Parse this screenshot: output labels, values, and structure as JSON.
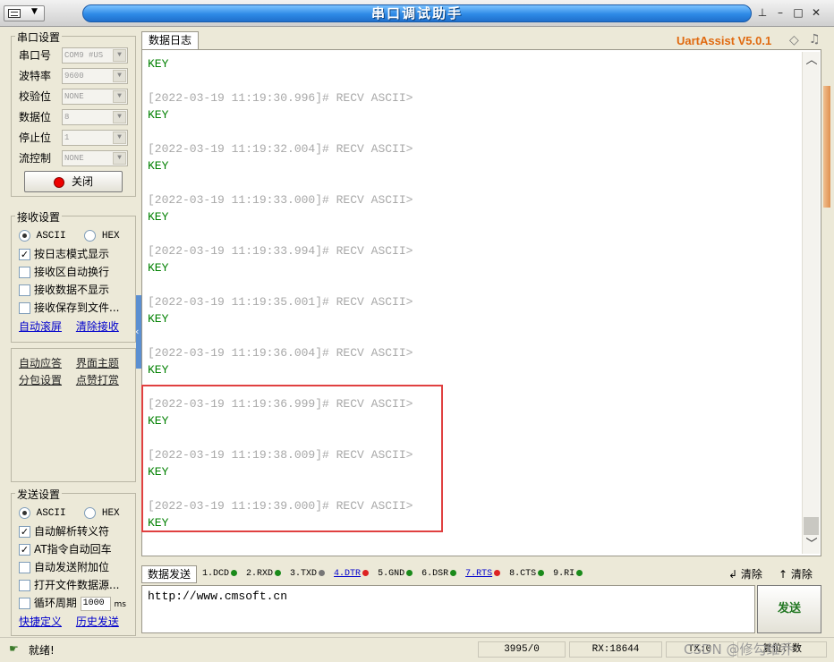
{
  "window": {
    "title": "串口调试助手",
    "controls": {
      "pin": "⊥",
      "minimize": "–",
      "maximize": "□",
      "close": "✕"
    }
  },
  "brand": {
    "name": "UartAssist V5.0.1",
    "color": "#e06a10"
  },
  "serial_settings": {
    "label": "串口设置",
    "fields": [
      {
        "label": "串口号",
        "value": "COM9 #US"
      },
      {
        "label": "波特率",
        "value": "9600"
      },
      {
        "label": "校验位",
        "value": "NONE"
      },
      {
        "label": "数据位",
        "value": "8"
      },
      {
        "label": "停止位",
        "value": "1"
      },
      {
        "label": "流控制",
        "value": "NONE"
      }
    ],
    "close_button": "关闭"
  },
  "receive_settings": {
    "label": "接收设置",
    "radio_ascii": "ASCII",
    "radio_hex": "HEX",
    "checks": [
      {
        "label": "按日志模式显示",
        "checked": true
      },
      {
        "label": "接收区自动换行",
        "checked": false
      },
      {
        "label": "接收数据不显示",
        "checked": false
      },
      {
        "label": "接收保存到文件...",
        "checked": false
      }
    ],
    "link_autoscroll": "自动滚屏",
    "link_clear": "清除接收"
  },
  "tools": {
    "auto_reply": "自动应答",
    "theme": "界面主题",
    "packet": "分包设置",
    "donate": "点赞打赏"
  },
  "send_settings": {
    "label": "发送设置",
    "radio_ascii": "ASCII",
    "radio_hex": "HEX",
    "checks": [
      {
        "label": "自动解析转义符",
        "checked": true
      },
      {
        "label": "AT指令自动回车",
        "checked": true
      },
      {
        "label": "自动发送附加位",
        "checked": false
      },
      {
        "label": "打开文件数据源...",
        "checked": false
      }
    ],
    "cycle_label": "循环周期",
    "cycle_value": "1000",
    "cycle_unit": "ms",
    "link_shortcut": "快捷定义",
    "link_history": "历史发送"
  },
  "log": {
    "tab": "数据日志",
    "first_line": "KEY",
    "entries": [
      {
        "ts": "[2022-03-19 11:19:30.996]# RECV ASCII>",
        "data": "KEY"
      },
      {
        "ts": "[2022-03-19 11:19:32.004]# RECV ASCII>",
        "data": "KEY"
      },
      {
        "ts": "[2022-03-19 11:19:33.000]# RECV ASCII>",
        "data": "KEY"
      },
      {
        "ts": "[2022-03-19 11:19:33.994]# RECV ASCII>",
        "data": "KEY"
      },
      {
        "ts": "[2022-03-19 11:19:35.001]# RECV ASCII>",
        "data": "KEY"
      },
      {
        "ts": "[2022-03-19 11:19:36.004]# RECV ASCII>",
        "data": "KEY"
      },
      {
        "ts": "[2022-03-19 11:19:36.999]# RECV ASCII>",
        "data": "KEY"
      },
      {
        "ts": "[2022-03-19 11:19:38.009]# RECV ASCII>",
        "data": "KEY"
      },
      {
        "ts": "[2022-03-19 11:19:39.000]# RECV ASCII>",
        "data": "KEY"
      }
    ]
  },
  "send": {
    "tab": "数据发送",
    "signals": [
      {
        "label": "1.DCD",
        "color": "#1a8a1a",
        "link": false
      },
      {
        "label": "2.RXD",
        "color": "#1a8a1a",
        "link": false
      },
      {
        "label": "3.TXD",
        "color": "#777777",
        "link": false
      },
      {
        "label": "4.DTR",
        "color": "#dd2222",
        "link": true
      },
      {
        "label": "5.GND",
        "color": "#1a8a1a",
        "link": false
      },
      {
        "label": "6.DSR",
        "color": "#1a8a1a",
        "link": false
      },
      {
        "label": "7.RTS",
        "color": "#dd2222",
        "link": true
      },
      {
        "label": "8.CTS",
        "color": "#1a8a1a",
        "link": false
      },
      {
        "label": "9.RI",
        "color": "#1a8a1a",
        "link": false
      }
    ],
    "clear1": "清除",
    "clear2": "清除",
    "input_value": "http://www.cmsoft.cn",
    "send_button": "发送"
  },
  "status": {
    "ready": "就绪!",
    "count": "3995/0",
    "rx": "RX:18644",
    "tx_partial": "TX:0",
    "reset": "复位计数",
    "watermark": "CSDN @修勾维乔"
  }
}
